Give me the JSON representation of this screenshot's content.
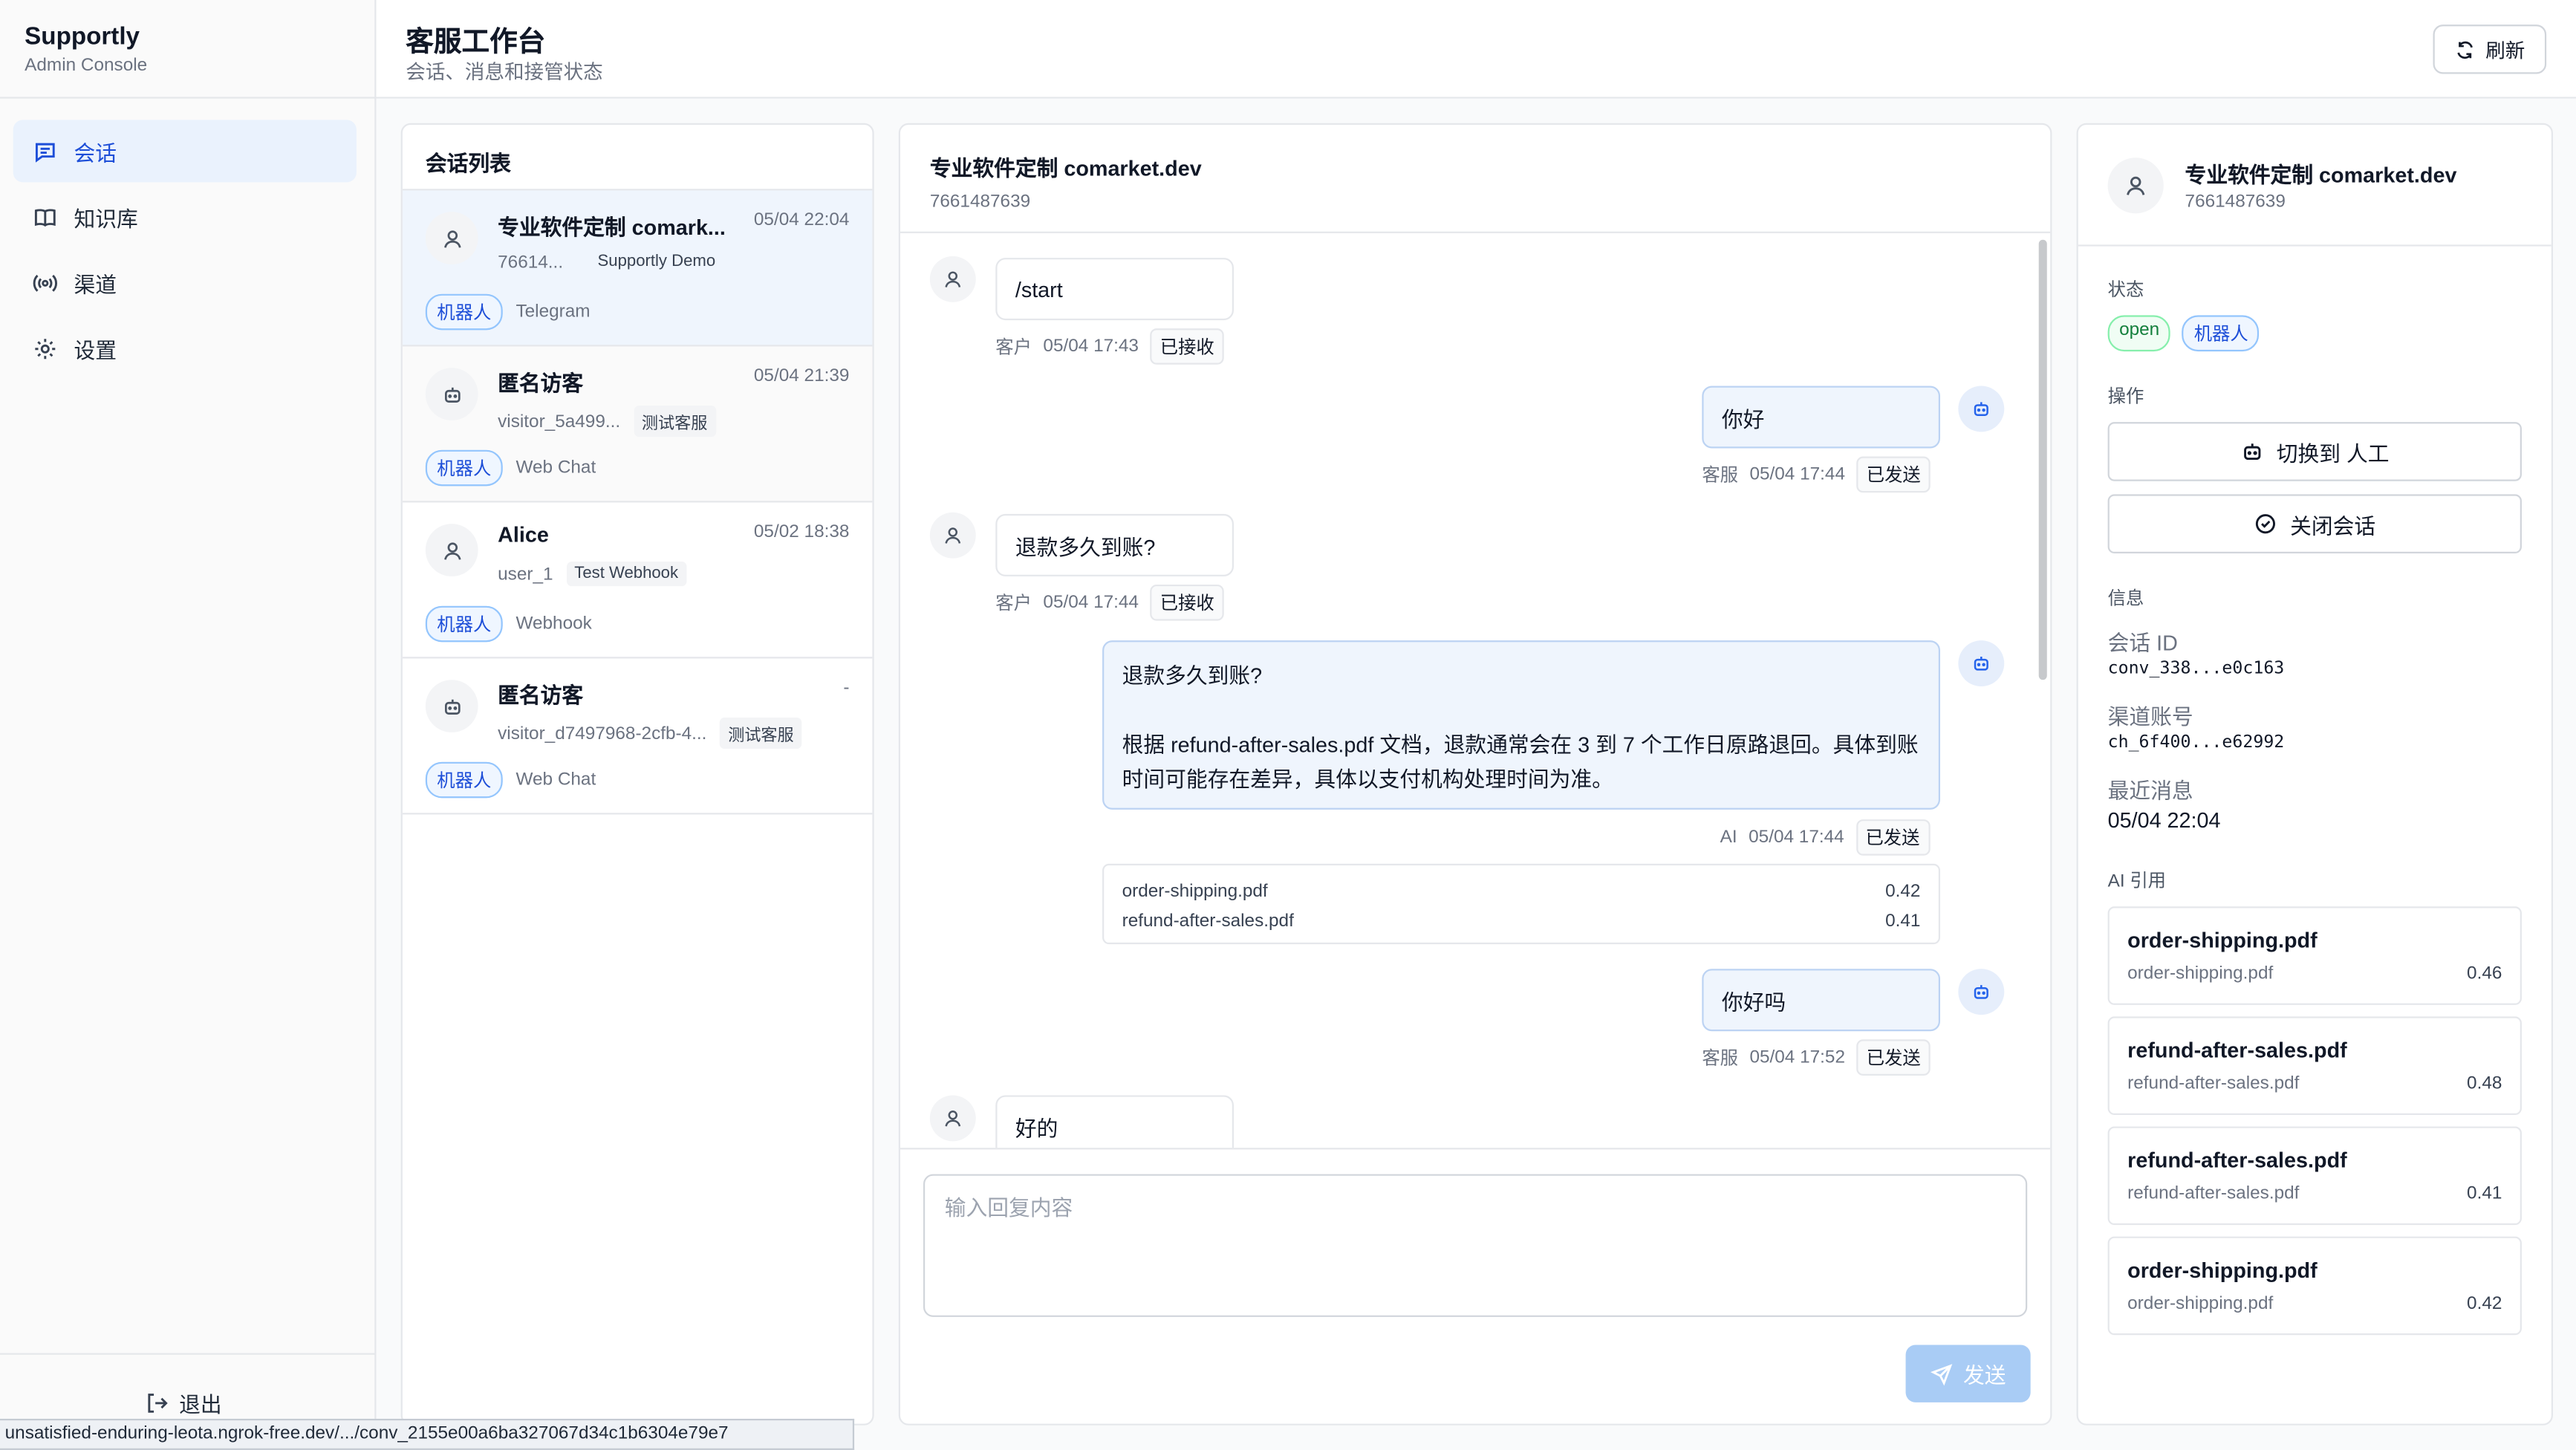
{
  "brand": {
    "name": "Supportly",
    "subtitle": "Admin Console"
  },
  "nav": [
    {
      "label": "会话",
      "icon": "message-icon",
      "active": true
    },
    {
      "label": "知识库",
      "icon": "book-icon",
      "active": false
    },
    {
      "label": "渠道",
      "icon": "radio-icon",
      "active": false
    },
    {
      "label": "设置",
      "icon": "gear-icon",
      "active": false
    }
  ],
  "logout_label": "退出",
  "header": {
    "title": "客服工作台",
    "subtitle": "会话、消息和接管状态",
    "refresh_label": "刷新"
  },
  "conversation_list": {
    "title": "会话列表",
    "items": [
      {
        "name": "专业软件定制 comark...",
        "time": "05/04 22:04",
        "id": "76614...",
        "tag": "Supportly Demo",
        "mode": "机器人",
        "channel": "Telegram",
        "avatar": "user-icon"
      },
      {
        "name": "匿名访客",
        "time": "05/04 21:39",
        "id": "visitor_5a499...",
        "tag": "测试客服",
        "mode": "机器人",
        "channel": "Web Chat",
        "avatar": "bot-icon"
      },
      {
        "name": "Alice",
        "time": "05/02 18:38",
        "id": "user_1",
        "tag": "Test Webhook",
        "mode": "机器人",
        "channel": "Webhook",
        "avatar": "user-icon"
      },
      {
        "name": "匿名访客",
        "time": "-",
        "id": "visitor_d7497968-2cfb-4...",
        "tag": "测试客服",
        "mode": "机器人",
        "channel": "Web Chat",
        "avatar": "bot-icon"
      }
    ]
  },
  "chat": {
    "title": "专业软件定制 comarket.dev",
    "subtitle": "7661487639",
    "messages": [
      {
        "text": "/start",
        "role": "客户",
        "time": "05/04 17:43",
        "status": "已接收"
      },
      {
        "text": "你好",
        "role": "客服",
        "time": "05/04 17:44",
        "status": "已发送"
      },
      {
        "text": "退款多久到账?",
        "role": "客户",
        "time": "05/04 17:44",
        "status": "已接收"
      },
      {
        "line1": "退款多久到账?",
        "line2": "根据 refund-after-sales.pdf 文档，退款通常会在 3 到 7 个工作日原路退回。具体到账",
        "line3": "时间可能存在差异，具体以支付机构处理时间为准。",
        "role": "AI",
        "time": "05/04 17:44",
        "status": "已发送"
      },
      {
        "text": "你好吗",
        "role": "客服",
        "time": "05/04 17:52",
        "status": "已发送"
      },
      {
        "text": "好的"
      }
    ],
    "citations": [
      {
        "file": "order-shipping.pdf",
        "score": "0.42"
      },
      {
        "file": "refund-after-sales.pdf",
        "score": "0.41"
      }
    ],
    "composer_placeholder": "输入回复内容",
    "send_label": "发送"
  },
  "info": {
    "name": "专业软件定制 comarket.dev",
    "id": "7661487639",
    "status_label": "状态",
    "status_open": "open",
    "status_mode": "机器人",
    "actions_label": "操作",
    "handover_label": "切换到 人工",
    "close_label": "关闭会话",
    "info_label": "信息",
    "conv_id_label": "会话 ID",
    "conv_id": "conv_338...e0c163",
    "channel_account_label": "渠道账号",
    "channel_account": "ch_6f400...e62992",
    "last_msg_label": "最近消息",
    "last_msg": "05/04 22:04",
    "ai_ref_label": "AI 引用",
    "refs": [
      {
        "title": "order-shipping.pdf",
        "file": "order-shipping.pdf",
        "score": "0.46"
      },
      {
        "title": "refund-after-sales.pdf",
        "file": "refund-after-sales.pdf",
        "score": "0.48"
      },
      {
        "title": "refund-after-sales.pdf",
        "file": "refund-after-sales.pdf",
        "score": "0.41"
      },
      {
        "title": "order-shipping.pdf",
        "file": "order-shipping.pdf",
        "score": "0.42"
      }
    ]
  },
  "status_url": "unsatisfied-enduring-leota.ngrok-free.dev/.../conv_2155e00a6ba327067d34c1b6304e79e7",
  "colors": {
    "accent": "#1d4ed8",
    "active_bg": "#eaf2fd",
    "send_disabled": "#a9ccf5"
  }
}
